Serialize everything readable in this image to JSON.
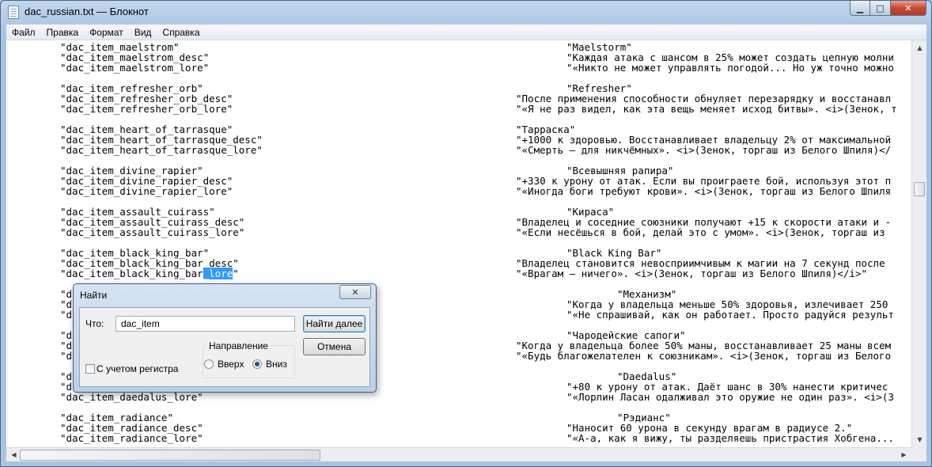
{
  "window": {
    "title": "dac_russian.txt — Блокнот"
  },
  "menu": [
    "Файл",
    "Правка",
    "Формат",
    "Вид",
    "Справка"
  ],
  "lines": [
    {
      "key": "\"dac_item_maelstrom\"",
      "value": "\"Maelstorm\"",
      "col": "b"
    },
    {
      "key": "\"dac_item_maelstrom_desc\"",
      "value": "\"Каждая атака с шансом в 25% может создать цепную молни",
      "col": "b"
    },
    {
      "key": "\"dac_item_maelstrom_lore\"",
      "value": "\"«Никто не может управлять погодой... Но уж точно можно",
      "col": "b"
    },
    {
      "key": "",
      "value": "",
      "col": "b"
    },
    {
      "key": "\"dac_item_refresher_orb\"",
      "value": "\"Refresher\"",
      "col": "b"
    },
    {
      "key": "\"dac_item_refresher_orb_desc\"",
      "value": "\"После применения способности обнуляет перезарядку и восстанавл",
      "col": "a"
    },
    {
      "key": "\"dac_item_refresher_orb_lore\"",
      "value": "\"«Я не раз видел, как эта вещь меняет исход битвы». <i>(Зенок, т",
      "col": "a"
    },
    {
      "key": "",
      "value": "",
      "col": "a"
    },
    {
      "key": "\"dac_item_heart_of_tarrasque\"",
      "value": "\"Тарраска\"",
      "col": "a"
    },
    {
      "key": "\"dac_item_heart_of_tarrasque_desc\"",
      "value": "\"+1000 к здоровью. Восстанавливает владельцу 2% от максимальной",
      "col": "a"
    },
    {
      "key": "\"dac_item_heart_of_tarrasque_lore\"",
      "value": "\"«Смерть – для никчёмных». <i>(Зенок, торгаш из Белого Шпиля)</",
      "col": "a"
    },
    {
      "key": "",
      "value": "",
      "col": "a"
    },
    {
      "key": "\"dac_item_divine_rapier\"",
      "value": "\"Всевышняя рапира\"",
      "col": "b"
    },
    {
      "key": "\"dac_item_divine_rapier_desc\"",
      "value": "\"+330 к урону от атак. Если вы проиграете бой, используя этот п",
      "col": "a"
    },
    {
      "key": "\"dac_item_divine_rapier_lore\"",
      "value": "\"«Иногда боги требуют крови». <i>(Зенок, торгаш из Белого Шпиля",
      "col": "a"
    },
    {
      "key": "",
      "value": "",
      "col": "a"
    },
    {
      "key": "\"dac_item_assault_cuirass\"",
      "value": "\"Кираса\"",
      "col": "b"
    },
    {
      "key": "\"dac_item_assault_cuirass_desc\"",
      "value": "\"Владелец и соседние союзники получают +15 к скорости атаки и -",
      "col": "a"
    },
    {
      "key": "\"dac_item_assault_cuirass_lore\"",
      "value": "\"«Если несёшься в бой, делай это с умом». <i>(Зенок, торгаш из",
      "col": "a"
    },
    {
      "key": "",
      "value": "",
      "col": "a"
    },
    {
      "key": "\"dac_item_black_king_bar\"",
      "value": "\"Black King Bar\"",
      "col": "b"
    },
    {
      "key": "\"dac_item_black_king_bar_desc\"",
      "value": "\"Владелец становится невосприимчивым к магии на 7 секунд после",
      "col": "a"
    },
    {
      "key": "\"dac_item_black_king_bar_lore\"",
      "value": "\"«Врагам – ничего». <i>(Зенок, торгаш из Белого Шпиля)</i>\"",
      "col": "a",
      "sel_start": 24,
      "sel_len": 5
    },
    {
      "key": "",
      "value": "",
      "col": "a"
    },
    {
      "key": "\"d",
      "value": "\"Механизм\"",
      "col": "c"
    },
    {
      "key": "\"d",
      "value": "\"Когда у владельца меньше 50% здоровья, излечивает 250",
      "col": "b"
    },
    {
      "key": "\"d",
      "value": "\"«Не спрашивай, как он работает. Просто радуйся результ",
      "col": "b"
    },
    {
      "key": "",
      "value": "",
      "col": "b"
    },
    {
      "key": "\"d",
      "value": "\"Чародейские сапоги\"",
      "col": "b"
    },
    {
      "key": "\"d",
      "value": "\"Когда у владельца более 50% маны, восстанавливает 25 маны всем",
      "col": "a"
    },
    {
      "key": "\"d",
      "value": "\"«Будь благожелателен к союзникам». <i>(Зенок, торгаш из Белого",
      "col": "a"
    },
    {
      "key": "",
      "value": "",
      "col": "a"
    },
    {
      "key": "\"d",
      "value": "\"Daedalus\"",
      "col": "c"
    },
    {
      "key": "\"d",
      "value": "\"+80 к урону от атак. Даёт шанс в 30% нанести критичес",
      "col": "b"
    },
    {
      "key": "\"dac_item_daedalus_lore\"",
      "value": "\"«Лорлин Ласан одалживал это оружие не один раз». <i>(З",
      "col": "b"
    },
    {
      "key": "",
      "value": "",
      "col": "b"
    },
    {
      "key": "\"dac_item_radiance\"",
      "value": "\"Рэдианс\"",
      "col": "c"
    },
    {
      "key": "\"dac_item_radiance_desc\"",
      "value": "\"Наносит 60 урона в секунду врагам в радиусе 2.\"",
      "col": "b"
    },
    {
      "key": "\"dac_item_radiance_lore\"",
      "value": "\"«А-а, как я вижу, ты разделяешь пристрастия Хобгена...",
      "col": "b"
    }
  ],
  "find_dialog": {
    "title": "Найти",
    "what_label": "Что:",
    "query": "dac_item",
    "find_next": "Найти далее",
    "cancel": "Отмена",
    "direction_label": "Направление",
    "up": "Вверх",
    "down": "Вниз",
    "match_case": "С учетом регистра",
    "direction_selected": "down",
    "match_case_checked": false
  },
  "scroll": {
    "vertical_position": 0.35,
    "horizontal_position": 0.0
  },
  "colors": {
    "selection": "#3399ff",
    "close_button": "#c74a33"
  }
}
